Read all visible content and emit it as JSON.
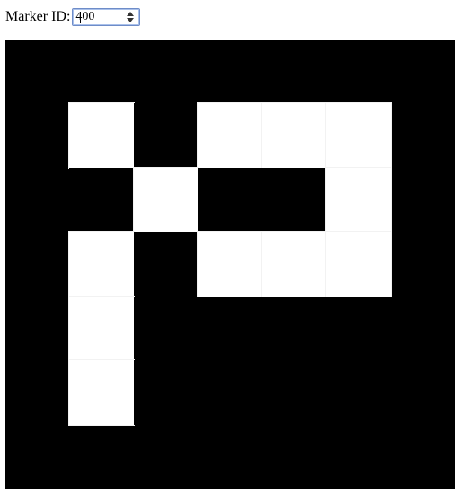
{
  "controls": {
    "marker_id_label": "Marker ID:",
    "marker_id_value": "400"
  },
  "marker": {
    "grid_size": 7,
    "inner_grid": [
      [
        1,
        0,
        1,
        1,
        1
      ],
      [
        0,
        1,
        0,
        0,
        1
      ],
      [
        1,
        0,
        1,
        1,
        1
      ],
      [
        1,
        0,
        0,
        0,
        0
      ],
      [
        1,
        0,
        0,
        0,
        0
      ]
    ],
    "colors": {
      "black": "#000000",
      "white": "#ffffff"
    }
  }
}
